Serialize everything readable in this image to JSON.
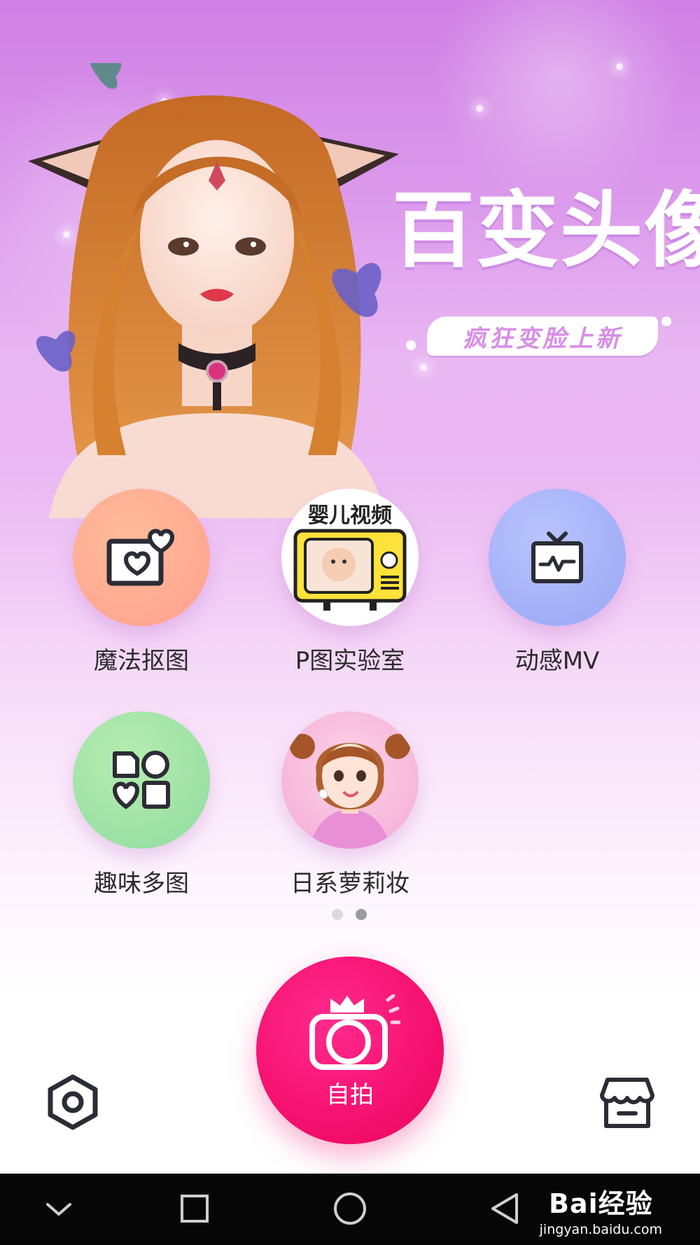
{
  "banner": {
    "title": "百变头像",
    "subtitle": "疯狂变脸上新"
  },
  "features": [
    {
      "label": "魔法抠图",
      "icon": "heart-photo-icon",
      "color": "#ffa98e"
    },
    {
      "label": "P图实验室",
      "icon": "baby-video-tv-icon",
      "badge_text": "婴儿视频",
      "color": "#ffe23a"
    },
    {
      "label": "动感MV",
      "icon": "tv-waveform-icon",
      "color": "#a9b6fb"
    },
    {
      "label": "趣味多图",
      "icon": "multi-shape-grid-icon",
      "color": "#9fe3a6"
    },
    {
      "label": "日系萝莉妆",
      "icon": "girl-portrait-icon",
      "color": "#f7a8d6"
    }
  ],
  "pager": {
    "count": 2,
    "active": 2
  },
  "selfie": {
    "label": "自拍",
    "icon": "crown-camera-icon",
    "color": "#f5116f"
  },
  "settings": {
    "icon": "hexagon-settings-icon"
  },
  "store": {
    "icon": "store-icon"
  },
  "navbar": {
    "icons": [
      "chevron-down-icon",
      "square-recents-icon",
      "circle-home-icon",
      "triangle-back-icon"
    ]
  },
  "watermark": {
    "main": "Bai经验",
    "url": "jingyan.baidu.com"
  }
}
